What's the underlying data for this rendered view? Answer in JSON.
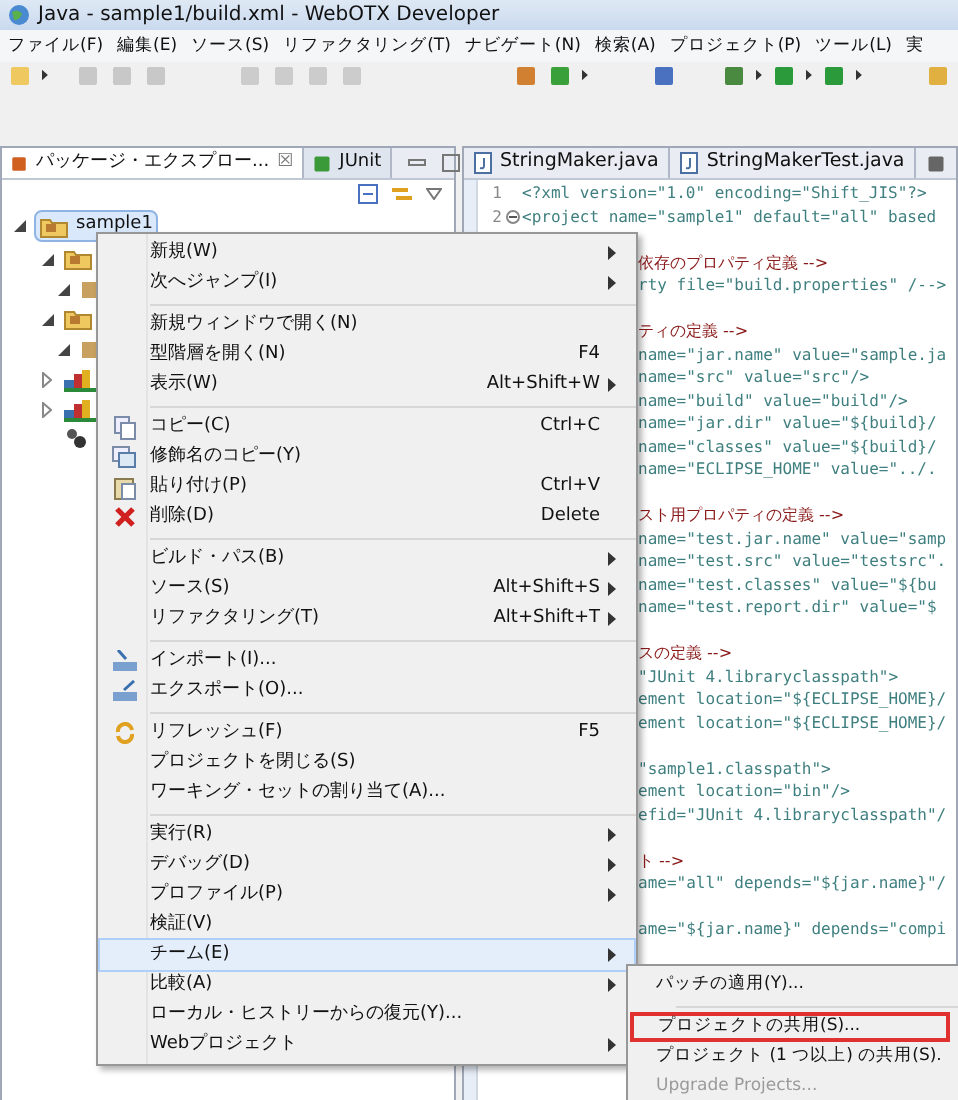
{
  "window": {
    "title": "Java - sample1/build.xml - WebOTX Developer"
  },
  "menu_bar": [
    "ファイル(F)",
    "編集(E)",
    "ソース(S)",
    "リファクタリング(T)",
    "ナビゲート(N)",
    "検索(A)",
    "プロジェクト(P)",
    "ツール(L)",
    "実"
  ],
  "explorer": {
    "tabs": [
      {
        "label": "パッケージ・エクスプロー...",
        "selected": true,
        "close": "☒"
      },
      {
        "label": "JUnit",
        "selected": false
      }
    ],
    "tree": {
      "label": "sample1",
      "selected": true,
      "expanded": true,
      "children": [
        {
          "kind": "source-folder",
          "expanded": true,
          "children": [
            {
              "kind": "package",
              "expanded": true
            }
          ]
        },
        {
          "kind": "source-folder",
          "expanded": true,
          "children": [
            {
              "kind": "package",
              "expanded": true
            }
          ]
        },
        {
          "kind": "library",
          "expanded": false
        },
        {
          "kind": "library",
          "expanded": false
        },
        {
          "kind": "file"
        }
      ]
    }
  },
  "editor": {
    "tabs": [
      {
        "label": "StringMaker.java",
        "selected": false
      },
      {
        "label": "StringMakerTest.java",
        "selected": false
      }
    ],
    "blocks": [
      [
        {
          "number": "1",
          "kind": "code",
          "text": "<?xml version=\"1.0\" encoding=\"Shift_JIS\"?>"
        },
        {
          "number": "2",
          "kind": "code",
          "fold": true,
          "text": "<project name=\"sample1\" default=\"all\" based"
        }
      ],
      [
        {
          "kind": "comment",
          "text": "依存のプロパティ定義 -->"
        },
        {
          "kind": "code",
          "text": "rty file=\"build.properties\" /-->"
        }
      ],
      [
        {
          "kind": "comment",
          "text": "ティの定義 -->"
        },
        {
          "kind": "code",
          "text": "name=\"jar.name\" value=\"sample.ja"
        },
        {
          "kind": "code",
          "text": "name=\"src\" value=\"src\"/>"
        },
        {
          "kind": "code",
          "text": "name=\"build\" value=\"build\"/>"
        },
        {
          "kind": "code",
          "text": "name=\"jar.dir\" value=\"${build}/"
        },
        {
          "kind": "code",
          "text": "name=\"classes\" value=\"${build}/"
        },
        {
          "kind": "code",
          "text": "name=\"ECLIPSE_HOME\" value=\"../."
        }
      ],
      [
        {
          "kind": "comment",
          "text": "スト用プロパティの定義 -->"
        },
        {
          "kind": "code",
          "text": "name=\"test.jar.name\" value=\"samp"
        },
        {
          "kind": "code",
          "text": "name=\"test.src\" value=\"testsrc\"."
        },
        {
          "kind": "code",
          "text": "name=\"test.classes\" value=\"${bu"
        },
        {
          "kind": "code",
          "text": "name=\"test.report.dir\" value=\"$"
        }
      ],
      [
        {
          "kind": "comment",
          "text": "スの定義 -->"
        },
        {
          "kind": "code",
          "text": "\"JUnit 4.libraryclasspath\">"
        },
        {
          "kind": "code",
          "text": "ement location=\"${ECLIPSE_HOME}/"
        },
        {
          "kind": "code",
          "text": "ement location=\"${ECLIPSE_HOME}/"
        }
      ],
      [
        {
          "kind": "code",
          "text": "\"sample1.classpath\">"
        },
        {
          "kind": "code",
          "text": "ement location=\"bin\"/>"
        },
        {
          "kind": "code",
          "text": "efid=\"JUnit 4.libraryclasspath\"/"
        }
      ],
      [
        {
          "kind": "comment",
          "text": "ト -->"
        },
        {
          "kind": "code",
          "text": "ame=\"all\" depends=\"${jar.name}\"/"
        }
      ],
      [
        {
          "kind": "code",
          "text": "ame=\"${jar.name}\" depends=\"compi"
        }
      ]
    ]
  },
  "context_menu": {
    "groups": [
      [
        {
          "label": "新規(W)",
          "submenu": true
        },
        {
          "label": "次へジャンプ(I)",
          "submenu": true
        }
      ],
      [
        {
          "label": "新規ウィンドウで開く(N)"
        },
        {
          "label": "型階層を開く(N)",
          "shortcut": "F4"
        },
        {
          "label": "表示(W)",
          "shortcut": "Alt+Shift+W",
          "submenu": true
        }
      ],
      [
        {
          "label": "コピー(C)",
          "shortcut": "Ctrl+C",
          "kind": "copy"
        },
        {
          "label": "修飾名のコピー(Y)",
          "kind": "copy-name"
        },
        {
          "label": "貼り付け(P)",
          "shortcut": "Ctrl+V",
          "kind": "paste"
        },
        {
          "label": "削除(D)",
          "shortcut": "Delete",
          "kind": "delete"
        }
      ],
      [
        {
          "label": "ビルド・パス(B)",
          "submenu": true
        },
        {
          "label": "ソース(S)",
          "shortcut": "Alt+Shift+S",
          "submenu": true
        },
        {
          "label": "リファクタリング(T)",
          "shortcut": "Alt+Shift+T",
          "submenu": true
        }
      ],
      [
        {
          "label": "インポート(I)...",
          "kind": "import"
        },
        {
          "label": "エクスポート(O)...",
          "kind": "export"
        }
      ],
      [
        {
          "label": "リフレッシュ(F)",
          "shortcut": "F5",
          "kind": "refresh"
        },
        {
          "label": "プロジェクトを閉じる(S)"
        },
        {
          "label": "ワーキング・セットの割り当て(A)..."
        }
      ],
      [
        {
          "label": "実行(R)",
          "submenu": true
        },
        {
          "label": "デバッグ(D)",
          "submenu": true
        },
        {
          "label": "プロファイル(P)",
          "submenu": true
        },
        {
          "label": "検証(V)"
        },
        {
          "label": "チーム(E)",
          "submenu": true,
          "selected": true
        },
        {
          "label": "比較(A)",
          "submenu": true
        },
        {
          "label": "ローカル・ヒストリーからの復元(Y)..."
        },
        {
          "label": "Webプロジェクト",
          "submenu": true
        }
      ]
    ]
  },
  "team_submenu": {
    "groups": [
      [
        {
          "label": "パッチの適用(Y)...",
          "disabled": false,
          "highlighted": false
        }
      ],
      [
        {
          "label": "プロジェクトの共用(S)...",
          "disabled": false,
          "highlighted": true
        },
        {
          "label": "プロジェクト (1 つ以上) の共用(S).",
          "disabled": false,
          "highlighted": false
        },
        {
          "label": "Upgrade Projects...",
          "disabled": true,
          "highlighted": false
        }
      ]
    ]
  }
}
